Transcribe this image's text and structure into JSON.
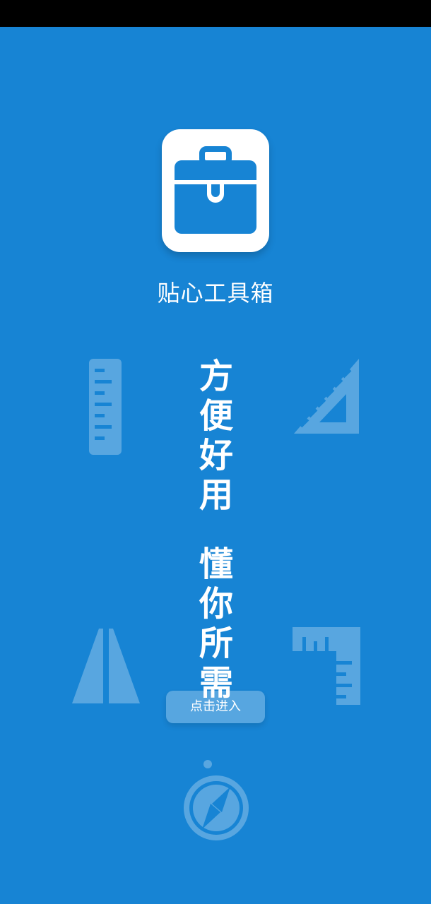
{
  "app": {
    "title": "贴心工具箱",
    "slogan_line1": "方便好用",
    "slogan_line2": "懂你所需",
    "enter_button": "点击进入"
  },
  "icons": {
    "app_logo": "toolbox-icon",
    "ruler": "ruler-icon",
    "triangle_ruler": "triangle-ruler-icon",
    "road": "road-icon",
    "angle_ruler": "angle-ruler-icon",
    "compass": "compass-icon"
  },
  "colors": {
    "background": "#1784d4",
    "icon_blue": "#1784d4",
    "white": "#ffffff"
  }
}
